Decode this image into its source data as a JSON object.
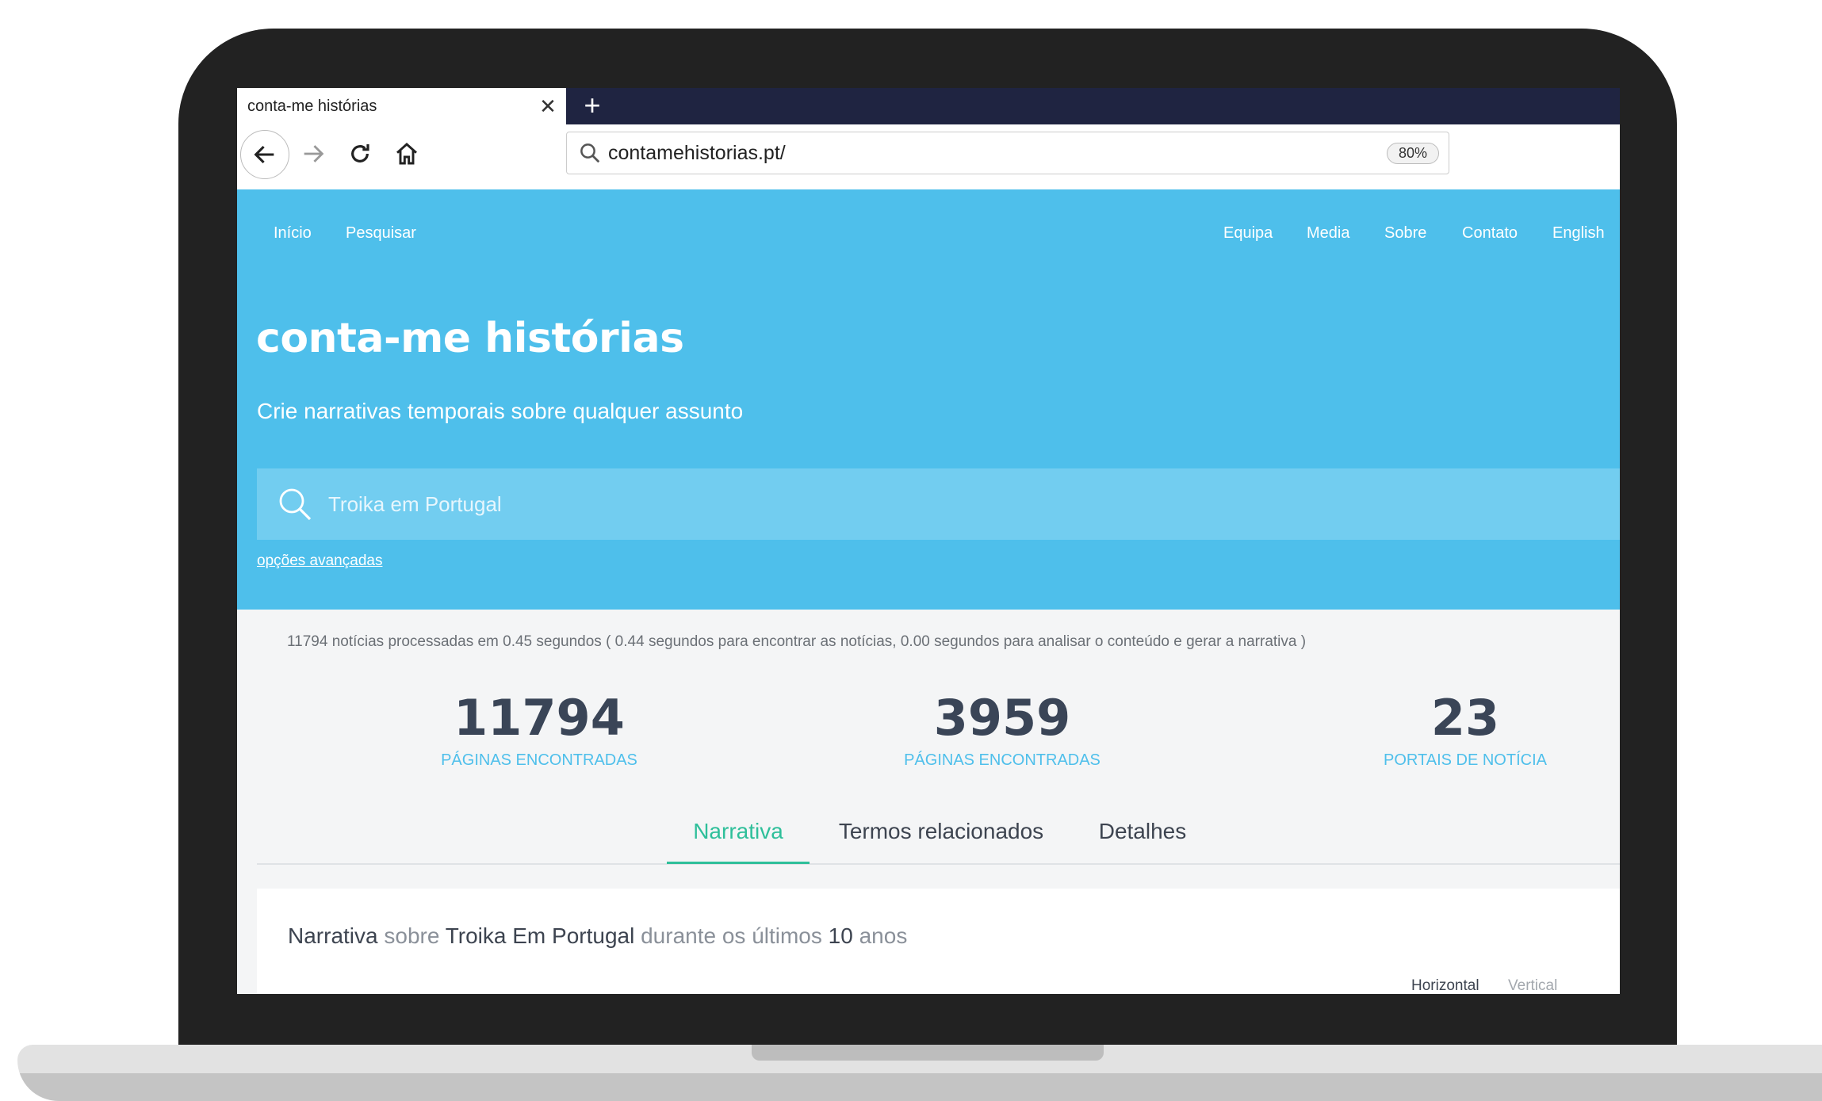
{
  "browser": {
    "tab_title": "conta-me histórias",
    "new_tab_symbol": "+",
    "url": "contamehistorias.pt/",
    "zoom": "80%"
  },
  "topnav": {
    "left": [
      "Início",
      "Pesquisar"
    ],
    "right": [
      "Equipa",
      "Media",
      "Sobre",
      "Contato",
      "English"
    ]
  },
  "hero": {
    "title": "conta-me histórias",
    "subtitle": "Crie narrativas temporais sobre qualquer assunto",
    "search_placeholder": "Troika em Portugal",
    "advanced_options": "opções avançadas"
  },
  "results": {
    "summary": "11794 notícias processadas em 0.45 segundos ( 0.44 segundos para encontrar as notícias, 0.00 segundos para analisar o conteúdo e gerar a narrativa )",
    "stats": [
      {
        "value": "11794",
        "label": "PÁGINAS ENCONTRADAS"
      },
      {
        "value": "3959",
        "label": "PÁGINAS ENCONTRADAS"
      },
      {
        "value": "23",
        "label": "PORTAIS DE NOTÍCIA"
      }
    ],
    "tabs": [
      "Narrativa",
      "Termos relacionados",
      "Detalhes"
    ],
    "active_tab": "Narrativa"
  },
  "narrative": {
    "word1": "Narrativa",
    "word2": "sobre",
    "topic": "Troika Em Portugal",
    "word3": "durante os últimos",
    "years": "10",
    "word4": "anos",
    "view_horizontal": "Horizontal",
    "view_vertical": "Vertical"
  },
  "colors": {
    "hero_bg": "#4ebfeb",
    "accent_green": "#2ebf9a",
    "stat_number": "#3a4557",
    "tabbar_bg": "#1f2441"
  }
}
